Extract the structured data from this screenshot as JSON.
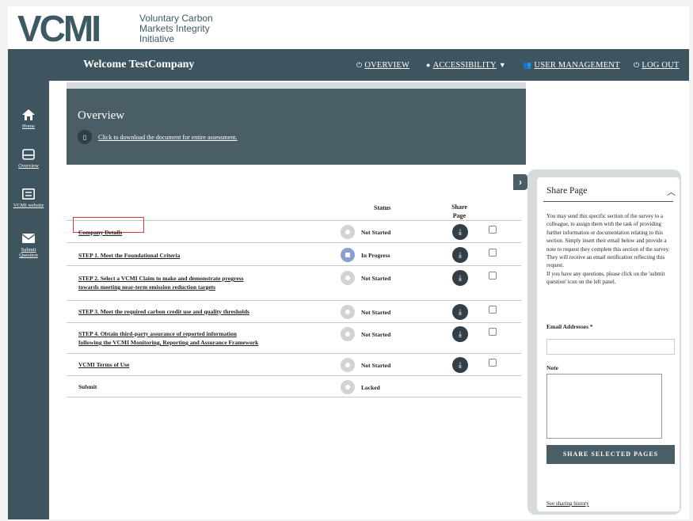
{
  "logo": {
    "mark": "VCMI",
    "line1": "Voluntary Carbon",
    "line2": "Markets Integrity",
    "line3": "Initiative"
  },
  "header": {
    "welcome": "Welcome TestCompany",
    "nav": {
      "overview": "OVERVIEW",
      "accessibility": "ACCESSIBILITY",
      "user_management": "USER MANAGEMENT",
      "logout": "LOG OUT"
    }
  },
  "sidebar": {
    "home": "Home",
    "overview": "Overview",
    "website": "VCMI website",
    "submit_line1": "Submit",
    "submit_line2": "Question"
  },
  "banner": {
    "title": "Overview",
    "download_link": "Click to download the document for entire assessment."
  },
  "table": {
    "status_header": "Status",
    "share_header_1": "Share",
    "share_header_2": "Page",
    "rows": [
      {
        "label": "Company Details",
        "status": "Not Started"
      },
      {
        "label": "STEP 1. Meet the Foundational Criteria",
        "status": "In Progress"
      },
      {
        "label_1": "STEP 2. Select a VCMI Claim to make and demonstrate progress",
        "label_2": "towards meeting near-term emission reduction targets",
        "status": "Not Started"
      },
      {
        "label": "STEP 3. Meet the required carbon credit use and quality thresholds",
        "status": "Not Started"
      },
      {
        "label_1": "STEP 4. Obtain third-party assurance of reported information",
        "label_2": "following the VCMI Monitoring, Reporting and Assurance Framework",
        "status": "Not Started"
      },
      {
        "label": "VCMI Terms of Use",
        "status": "Not Started"
      },
      {
        "label": "Submit",
        "status": "Locked"
      }
    ]
  },
  "share_panel": {
    "title": "Share Page",
    "description": "You may send this specific section of the survey to a colleague, to assign them with the task of providing further information or documentation relating to this section. Simply insert their email below and provide a note to request they complete this section of the survey. They will receive an email notification reflecting this request.",
    "description_2": "If you have any questions, please click on the 'submit question' icon on the left panel.",
    "email_label": "Email Addresses *",
    "note_label": "Note",
    "share_button": "SHARE SELECTED PAGES",
    "history_link": "See sharing history"
  }
}
